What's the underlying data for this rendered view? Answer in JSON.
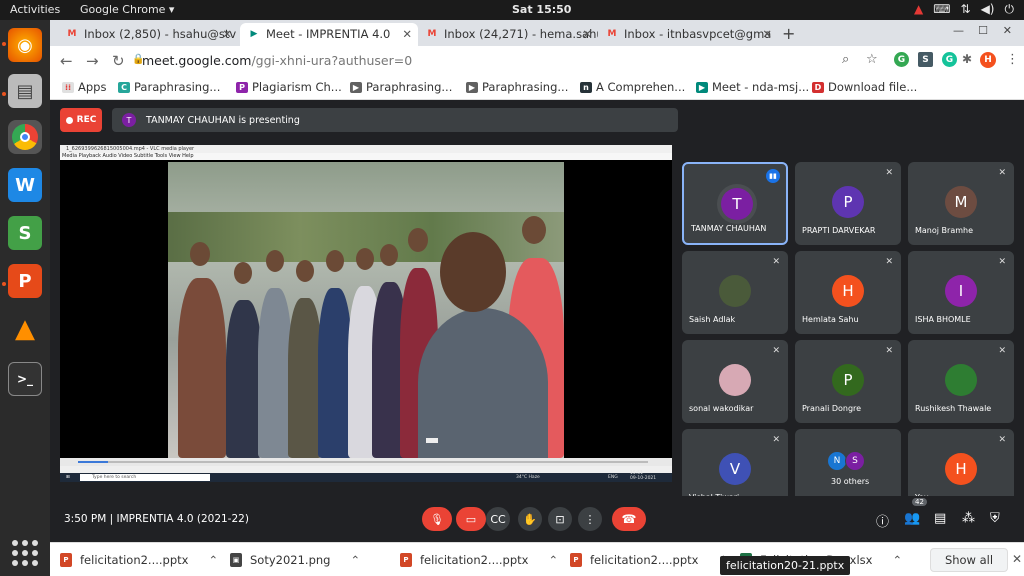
{
  "os": {
    "activities": "Activities",
    "app": "Google Chrome ▾",
    "clock": "Sat 15:50"
  },
  "tabs": [
    {
      "label": "Inbox (2,850) - hsahu@stv",
      "fav": "M",
      "color": "#ea4335"
    },
    {
      "label": "Meet - IMPRENTIA 4.0",
      "fav": "▶",
      "color": "#00897b"
    },
    {
      "label": "Inbox (24,271) - hema.sahu",
      "fav": "M",
      "color": "#ea4335"
    },
    {
      "label": "Inbox - itnbasvpcet@gma",
      "fav": "M",
      "color": "#ea4335"
    }
  ],
  "url": {
    "host": "meet.google.com",
    "path": "/ggi-xhni-ura?authuser=0"
  },
  "bookmarks": [
    "Apps",
    "Paraphrasing...",
    "Plagiarism Ch...",
    "Paraphrasing...",
    "Paraphrasing...",
    "A Comprehen...",
    "Meet - nda-msj...",
    "Download file..."
  ],
  "meet": {
    "rec": "REC",
    "presenter": "TANMAY CHAUHAN is presenting",
    "presenter_initial": "T",
    "vlc_title": "1_6269399626815005004.mp4 - VLC media player",
    "vlc_menu": "Media  Playback  Audio  Video  Subtitle  Tools  View  Help",
    "taskbar_search": "Type here to search",
    "taskbar_weather": "34°C Haze",
    "taskbar_time": "15:51",
    "taskbar_date": "09-10-2021",
    "taskbar_lang": "ENG",
    "participants": [
      {
        "name": "TANMAY CHAUHAN",
        "initial": "T",
        "color": "#7b1fa2",
        "speaking": true
      },
      {
        "name": "PRAPTI DARVEKAR",
        "initial": "P",
        "color": "#5e35b1"
      },
      {
        "name": "Manoj Bramhe",
        "initial": "M",
        "color": "#6d4c41"
      },
      {
        "name": "Saish Adlak",
        "initial": "",
        "color": "#4a5a3a"
      },
      {
        "name": "Hemlata Sahu",
        "initial": "H",
        "color": "#f4511e"
      },
      {
        "name": "ISHA BHOMLE",
        "initial": "I",
        "color": "#8e24aa"
      },
      {
        "name": "sonal wakodikar",
        "initial": "",
        "color": "#d7a9b4"
      },
      {
        "name": "Pranali Dongre",
        "initial": "P",
        "color": "#33691e"
      },
      {
        "name": "Rushikesh Thawale",
        "initial": "",
        "color": "#2e7d32"
      },
      {
        "name": "Vishal Tiwari",
        "initial": "V",
        "color": "#3f51b5"
      },
      {
        "name": "30 others",
        "initial": "",
        "color": "#3c4043"
      },
      {
        "name": "You",
        "initial": "H",
        "color": "#f4511e"
      }
    ],
    "others_initials": [
      "N",
      "S"
    ],
    "time_title": "3:50 PM  |  IMPRENTIA 4.0 (2021-22)",
    "people_count": "42"
  },
  "downloads": [
    {
      "name": "felicitation2....pptx",
      "color": "#d24726",
      "ico": "P"
    },
    {
      "name": "Soty2021.png",
      "color": "#444",
      "ico": "▣"
    },
    {
      "name": "felicitation2....pptx",
      "color": "#d24726",
      "ico": "P"
    },
    {
      "name": "felicitation2....pptx",
      "color": "#d24726",
      "ico": "P"
    },
    {
      "name": "Felicitation D....xlsx",
      "color": "#1e7145",
      "ico": "X"
    }
  ],
  "show_all": "Show all",
  "tooltip": "felicitation20-21.pptx"
}
